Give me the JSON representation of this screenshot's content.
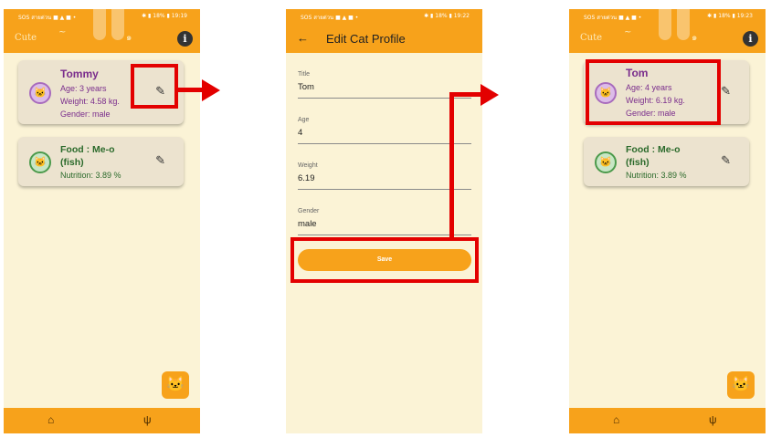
{
  "status_bar": {
    "left": "SOS สายด่วน ■ ▲ ■ •",
    "right_1": "✱ ▮ 18% ▮ 19:19",
    "right_2": "✱ ▮ 18% ▮ 19:22",
    "right_3": "✱ ▮ 18% ▮ 19:23"
  },
  "header": {
    "info_icon": "i",
    "deco_text_1": "Cute",
    "deco_text_2": "~",
    "deco_text_3": "๑"
  },
  "screen1": {
    "cat_card": {
      "name": "Tommy",
      "age": "Age: 3 years",
      "weight": "Weight: 4.58 kg.",
      "gender": "Gender: male"
    },
    "food_card": {
      "title_line1": "Food : Me-o",
      "title_line2": "(fish)",
      "nutrition": "Nutrition: 3.89 %"
    }
  },
  "screen2": {
    "appbar_title": "Edit Cat Profile",
    "fields": [
      {
        "label": "Title",
        "value": "Tom"
      },
      {
        "label": "Age",
        "value": "4"
      },
      {
        "label": "Weight",
        "value": "6.19"
      },
      {
        "label": "Gender",
        "value": "male"
      }
    ],
    "save_label": "Save"
  },
  "screen3": {
    "cat_card": {
      "name": "Tom",
      "age": "Age: 4 years",
      "weight": "Weight: 6.19 kg.",
      "gender": "Gender: male"
    },
    "food_card": {
      "title_line1": "Food : Me-o",
      "title_line2": "(fish)",
      "nutrition": "Nutrition: 3.89 %"
    }
  },
  "icons": {
    "cat_avatar": "cat-face-icon",
    "food_avatar": "cat-face-icon",
    "edit": "pencil-icon",
    "fab": "add-cat-icon",
    "home": "home-icon",
    "food": "fork-knife-icon",
    "back": "back-arrow-icon"
  },
  "colors": {
    "primary_orange": "#f7a21b",
    "background": "#fbf3d6",
    "card": "#ece3cf",
    "cat_text": "#7a2d8c",
    "food_text": "#2b6a2b",
    "annotation_red": "#e30000"
  }
}
